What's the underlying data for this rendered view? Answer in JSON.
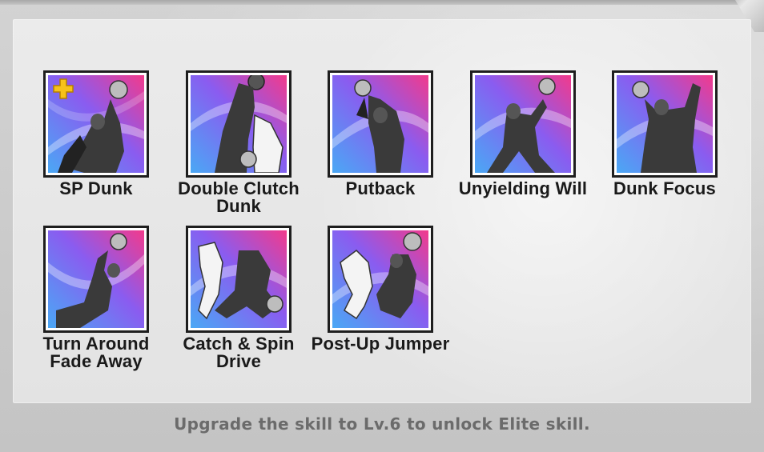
{
  "skills": [
    {
      "label": "SP Dunk",
      "icon": "sp-dunk-icon",
      "has_plus": true
    },
    {
      "label": "Double Clutch Dunk",
      "icon": "double-clutch-dunk-icon",
      "has_plus": false
    },
    {
      "label": "Putback",
      "icon": "putback-icon",
      "has_plus": false
    },
    {
      "label": "Unyielding Will",
      "icon": "unyielding-will-icon",
      "has_plus": false
    },
    {
      "label": "Dunk Focus",
      "icon": "dunk-focus-icon",
      "has_plus": false
    },
    {
      "label": "Turn Around Fade Away",
      "icon": "turn-around-fade-away-icon",
      "has_plus": false
    },
    {
      "label": "Catch & Spin Drive",
      "icon": "catch-spin-drive-icon",
      "has_plus": false
    },
    {
      "label": "Post-Up Jumper",
      "icon": "post-up-jumper-icon",
      "has_plus": false
    }
  ],
  "footer_text": "Upgrade the skill to Lv.6 to unlock Elite skill.",
  "colors": {
    "tile_pink": "#f23a8c",
    "tile_purple": "#8a5cf0",
    "tile_blue": "#4aa8f5",
    "plus_yellow": "#f7c21b"
  }
}
